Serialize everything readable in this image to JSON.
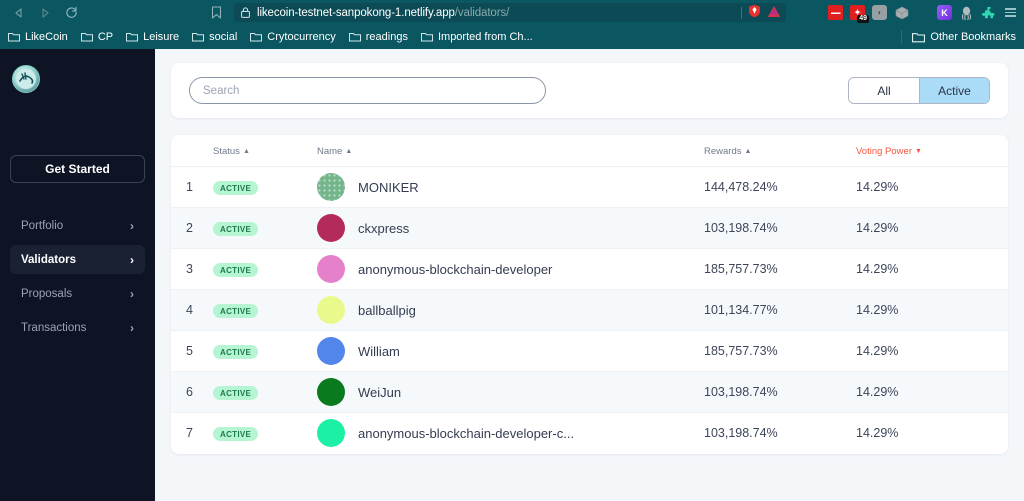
{
  "browser": {
    "nav": {
      "back_icon": "back-arrow-icon",
      "forward_icon": "forward-arrow-icon",
      "reload_icon": "reload-icon",
      "bookmark_icon": "bookmark-star-icon"
    },
    "omnibox": {
      "lock_icon": "lock-icon",
      "url_main": "likecoin-testnet-sanpokong-1.netlify.app",
      "url_path": "/validators/",
      "right_icons": [
        "brave-shield-icon",
        "warning-triangle-icon"
      ]
    },
    "extensions": [
      {
        "name": "metamask-icon",
        "label": "",
        "color": "#e02020",
        "badge": ""
      },
      {
        "name": "notification-icon",
        "label": "",
        "color": "#e02020",
        "badge": "49"
      },
      {
        "name": "chat-bubble-icon",
        "label": "",
        "color": "#98a0a4",
        "badge": ""
      },
      {
        "name": "cube-icon",
        "label": "",
        "color": "#9aa3a8",
        "badge": ""
      },
      {
        "name": "keplr-icon",
        "label": "K",
        "color": "#7d3ef2",
        "badge": ""
      },
      {
        "name": "octopus-icon",
        "label": "",
        "color": "#b8bfc4",
        "badge": ""
      },
      {
        "name": "puzzle-extension-icon",
        "label": "",
        "color": "#2fd6b0",
        "badge": ""
      }
    ],
    "menu_icon": "hamburger-menu-icon",
    "bookmarks": [
      {
        "label": "LikeCoin"
      },
      {
        "label": "CP"
      },
      {
        "label": "Leisure"
      },
      {
        "label": "social"
      },
      {
        "label": "Crytocurrency"
      },
      {
        "label": "readings"
      },
      {
        "label": "Imported from Ch..."
      }
    ],
    "other_bookmarks": "Other Bookmarks"
  },
  "sidebar": {
    "logo_name": "likecoin-logo",
    "get_started_label": "Get Started",
    "items": [
      {
        "label": "Portfolio",
        "active": false
      },
      {
        "label": "Validators",
        "active": true
      },
      {
        "label": "Proposals",
        "active": false
      },
      {
        "label": "Transactions",
        "active": false
      }
    ],
    "chevron": "›"
  },
  "search": {
    "value": "",
    "placeholder": "Search"
  },
  "filter_toggle": {
    "options": [
      {
        "label": "All",
        "selected": false
      },
      {
        "label": "Active",
        "selected": true
      }
    ],
    "selected_color": "#aadcf7"
  },
  "table": {
    "columns": [
      {
        "key": "index",
        "label": "",
        "sort": ""
      },
      {
        "key": "status",
        "label": "Status",
        "sort": "asc",
        "active": false
      },
      {
        "key": "name",
        "label": "Name",
        "sort": "asc",
        "active": false
      },
      {
        "key": "rewards",
        "label": "Rewards",
        "sort": "asc",
        "active": false
      },
      {
        "key": "voting_power",
        "label": "Voting Power",
        "sort": "desc",
        "active": true
      }
    ],
    "sort_asc_glyph": "▲",
    "sort_desc_glyph": "▼",
    "active_sort_color": "#f4573c",
    "rows": [
      {
        "index": "1",
        "status": "ACTIVE",
        "name": "MONIKER",
        "avatar_color": "#74b58c",
        "avatar_pattern": "dotted",
        "rewards": "144,478.24%",
        "voting_power": "14.29%"
      },
      {
        "index": "2",
        "status": "ACTIVE",
        "name": "ckxpress",
        "avatar_color": "#b32a5c",
        "avatar_pattern": "solid",
        "rewards": "103,198.74%",
        "voting_power": "14.29%"
      },
      {
        "index": "3",
        "status": "ACTIVE",
        "name": "anonymous-blockchain-developer",
        "avatar_color": "#e581cb",
        "avatar_pattern": "solid",
        "rewards": "185,757.73%",
        "voting_power": "14.29%"
      },
      {
        "index": "4",
        "status": "ACTIVE",
        "name": "ballballpig",
        "avatar_color": "#eaf98c",
        "avatar_pattern": "solid",
        "rewards": "101,134.77%",
        "voting_power": "14.29%"
      },
      {
        "index": "5",
        "status": "ACTIVE",
        "name": "William",
        "avatar_color": "#5286ea",
        "avatar_pattern": "solid",
        "rewards": "185,757.73%",
        "voting_power": "14.29%"
      },
      {
        "index": "6",
        "status": "ACTIVE",
        "name": "WeiJun",
        "avatar_color": "#0a7a1e",
        "avatar_pattern": "solid",
        "rewards": "103,198.74%",
        "voting_power": "14.29%"
      },
      {
        "index": "7",
        "status": "ACTIVE",
        "name": "anonymous-blockchain-developer-c...",
        "avatar_color": "#1cf0a4",
        "avatar_pattern": "solid",
        "rewards": "103,198.74%",
        "voting_power": "14.29%"
      }
    ]
  }
}
